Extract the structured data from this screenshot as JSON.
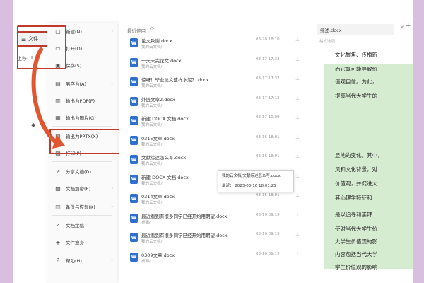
{
  "toolbar": {
    "file_label": "文件",
    "sub_label": "上移",
    "sub_label2": "L"
  },
  "menu": {
    "items": [
      {
        "label": "新建(N)",
        "icon": "new-doc-icon",
        "arrow": true
      },
      {
        "label": "打开(O)",
        "icon": "open-folder-icon",
        "arrow": false
      },
      {
        "label": "保存(S)",
        "icon": "save-icon",
        "arrow": false
      },
      {
        "label": "另存为(A)",
        "icon": "save-as-icon",
        "arrow": true
      },
      {
        "label": "输出为PDF(F)",
        "icon": "pdf-icon",
        "arrow": false
      },
      {
        "label": "输出为图片(G)",
        "icon": "image-icon",
        "arrow": false
      },
      {
        "label": "输出为PPTX(X)",
        "icon": "pptx-icon",
        "arrow": false
      },
      {
        "label": "打印(P)",
        "icon": "print-icon",
        "arrow": true
      },
      {
        "label": "分享文档(D)",
        "icon": "share-icon",
        "arrow": false
      },
      {
        "label": "文档加密(E)",
        "icon": "lock-icon",
        "arrow": true
      },
      {
        "label": "备份与恢复(K)",
        "icon": "backup-icon",
        "arrow": true
      },
      {
        "label": "文档定稿",
        "icon": "finalize-icon",
        "arrow": false
      },
      {
        "label": "文件瘦身",
        "icon": "slim-icon",
        "arrow": false
      },
      {
        "label": "帮助(H)",
        "icon": "help-icon",
        "arrow": true
      }
    ]
  },
  "recent": {
    "title": "最近使用",
    "docs": [
      {
        "name": "论文致谢.docx",
        "loc": "我的云文档/",
        "date": "03-20 18:10"
      },
      {
        "name": "一天未完论文.docx",
        "loc": "我的云文档/",
        "date": "03-17 17:33"
      },
      {
        "name": "惊呀！毕业论文这样水泥？.docx",
        "loc": "我的云文档/",
        "date": "03-17 17:32"
      },
      {
        "name": "外链文章2.docx",
        "loc": "我的云文档/",
        "date": "03-17 17:12"
      },
      {
        "name": "新建 DOCX 文档.docx",
        "loc": "我的云文档/",
        "date": "03-17 10:09"
      },
      {
        "name": "0315文章.docx",
        "loc": "我的云文档/",
        "date": "03-16 18:01"
      },
      {
        "name": "文献综述怎么写.docx",
        "loc": "我的云文档/",
        "date": "03-16 18:01"
      },
      {
        "name": "新建 DOCX 文档.docx",
        "loc": "我的云文档/",
        "date": "03-16 10:22"
      },
      {
        "name": "0314文章.docx",
        "loc": "我的云文档/",
        "date": "03-15 18:01"
      },
      {
        "name": "最近看到有很多同学已经开始用期望.docx",
        "loc": "桌面/",
        "date": "03-10 09:19"
      },
      {
        "name": "最近看到有很多同学已经开始用期望.docx",
        "loc": "我的云文档/",
        "date": "03-10 09:19"
      },
      {
        "name": "0309文章.docx",
        "loc": "桌面/",
        "date": "03-10 09:19"
      }
    ]
  },
  "tooltip": {
    "path": "我的云文档/文献综述怎么写.docx",
    "recent_label": "最近：",
    "recent_time": "2023-03-16 18:01:25"
  },
  "right_panel": {
    "tab_label": "综述.docx",
    "sub_label": "格式选项"
  },
  "doc_lines": [
    "文化聚焦、传播新",
    "而它既可能导致价",
    "值观自信。为此，",
    "提高当代大学生的",
    "显地的变化。其中，",
    "风和文化背景，对",
    "价值观，并促进大",
    "其心理学特征和",
    "是以追寻和崇拜",
    "使对当代大学生价",
    "大学生价值观的影",
    "内容包括当代大学",
    "学生价值观的影响"
  ],
  "colors": {
    "highlight_red": "#c0392b",
    "doc_green": "#d6ecd1",
    "frame_border": "#d8bfe0",
    "word_blue": "#2f6fd0"
  }
}
